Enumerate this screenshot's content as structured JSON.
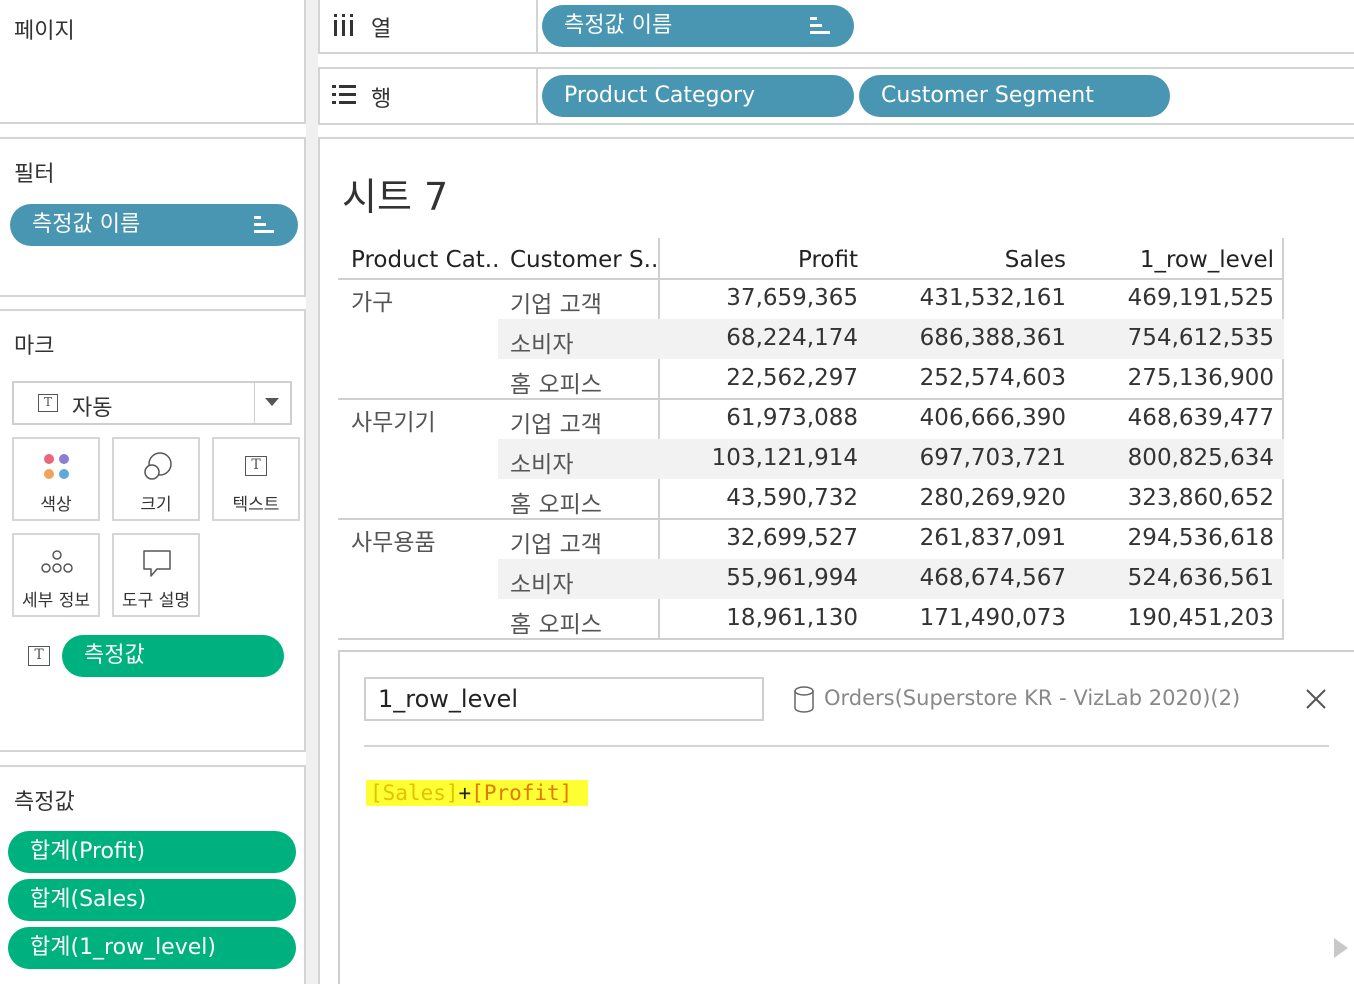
{
  "left": {
    "pages": {
      "title": "페이지"
    },
    "filters": {
      "title": "필터",
      "pill": "측정값 이름"
    },
    "marks": {
      "title": "마크",
      "mark_type": "자동",
      "buttons": [
        {
          "label": "색상",
          "icon": "color-dots-icon"
        },
        {
          "label": "크기",
          "icon": "size-circles-icon"
        },
        {
          "label": "텍스트",
          "icon": "text-icon"
        },
        {
          "label": "세부 정보",
          "icon": "detail-dots-icon"
        },
        {
          "label": "도구 설명",
          "icon": "tooltip-icon"
        }
      ],
      "text_pill": "측정값"
    },
    "measure_values": {
      "title": "측정값",
      "pills": [
        "합계(Profit)",
        "합계(Sales)",
        "합계(1_row_level)"
      ]
    }
  },
  "shelves": {
    "columns": {
      "label": "열",
      "pills": [
        "측정값 이름"
      ]
    },
    "rows": {
      "label": "행",
      "pills": [
        "Product Category",
        "Customer Segment"
      ]
    }
  },
  "sheet": {
    "title": "시트 7",
    "headers": [
      "Product Cat..",
      "Customer S..",
      "Profit",
      "Sales",
      "1_row_level"
    ],
    "groups": [
      {
        "category": "가구",
        "rows": [
          {
            "segment": "기업 고객",
            "profit": "37,659,365",
            "sales": "431,532,161",
            "level": "469,191,525"
          },
          {
            "segment": "소비자",
            "profit": "68,224,174",
            "sales": "686,388,361",
            "level": "754,612,535"
          },
          {
            "segment": "홈 오피스",
            "profit": "22,562,297",
            "sales": "252,574,603",
            "level": "275,136,900"
          }
        ]
      },
      {
        "category": "사무기기",
        "rows": [
          {
            "segment": "기업 고객",
            "profit": "61,973,088",
            "sales": "406,666,390",
            "level": "468,639,477"
          },
          {
            "segment": "소비자",
            "profit": "103,121,914",
            "sales": "697,703,721",
            "level": "800,825,634"
          },
          {
            "segment": "홈 오피스",
            "profit": "43,590,732",
            "sales": "280,269,920",
            "level": "323,860,652"
          }
        ]
      },
      {
        "category": "사무용품",
        "rows": [
          {
            "segment": "기업 고객",
            "profit": "32,699,527",
            "sales": "261,837,091",
            "level": "294,536,618"
          },
          {
            "segment": "소비자",
            "profit": "55,961,994",
            "sales": "468,674,567",
            "level": "524,636,561"
          },
          {
            "segment": "홈 오피스",
            "profit": "18,961,130",
            "sales": "171,490,073",
            "level": "190,451,203"
          }
        ]
      }
    ]
  },
  "calc_editor": {
    "field_name": "1_row_level",
    "datasource": "Orders(Superstore KR - VizLab 2020)(2)",
    "formula_part1": "[Sales]",
    "formula_op": "+",
    "formula_part2": "[Profit]",
    "highlight_color": "#ffff33"
  },
  "colors": {
    "pill_blue": "#4996b2",
    "pill_green": "#00b180"
  }
}
